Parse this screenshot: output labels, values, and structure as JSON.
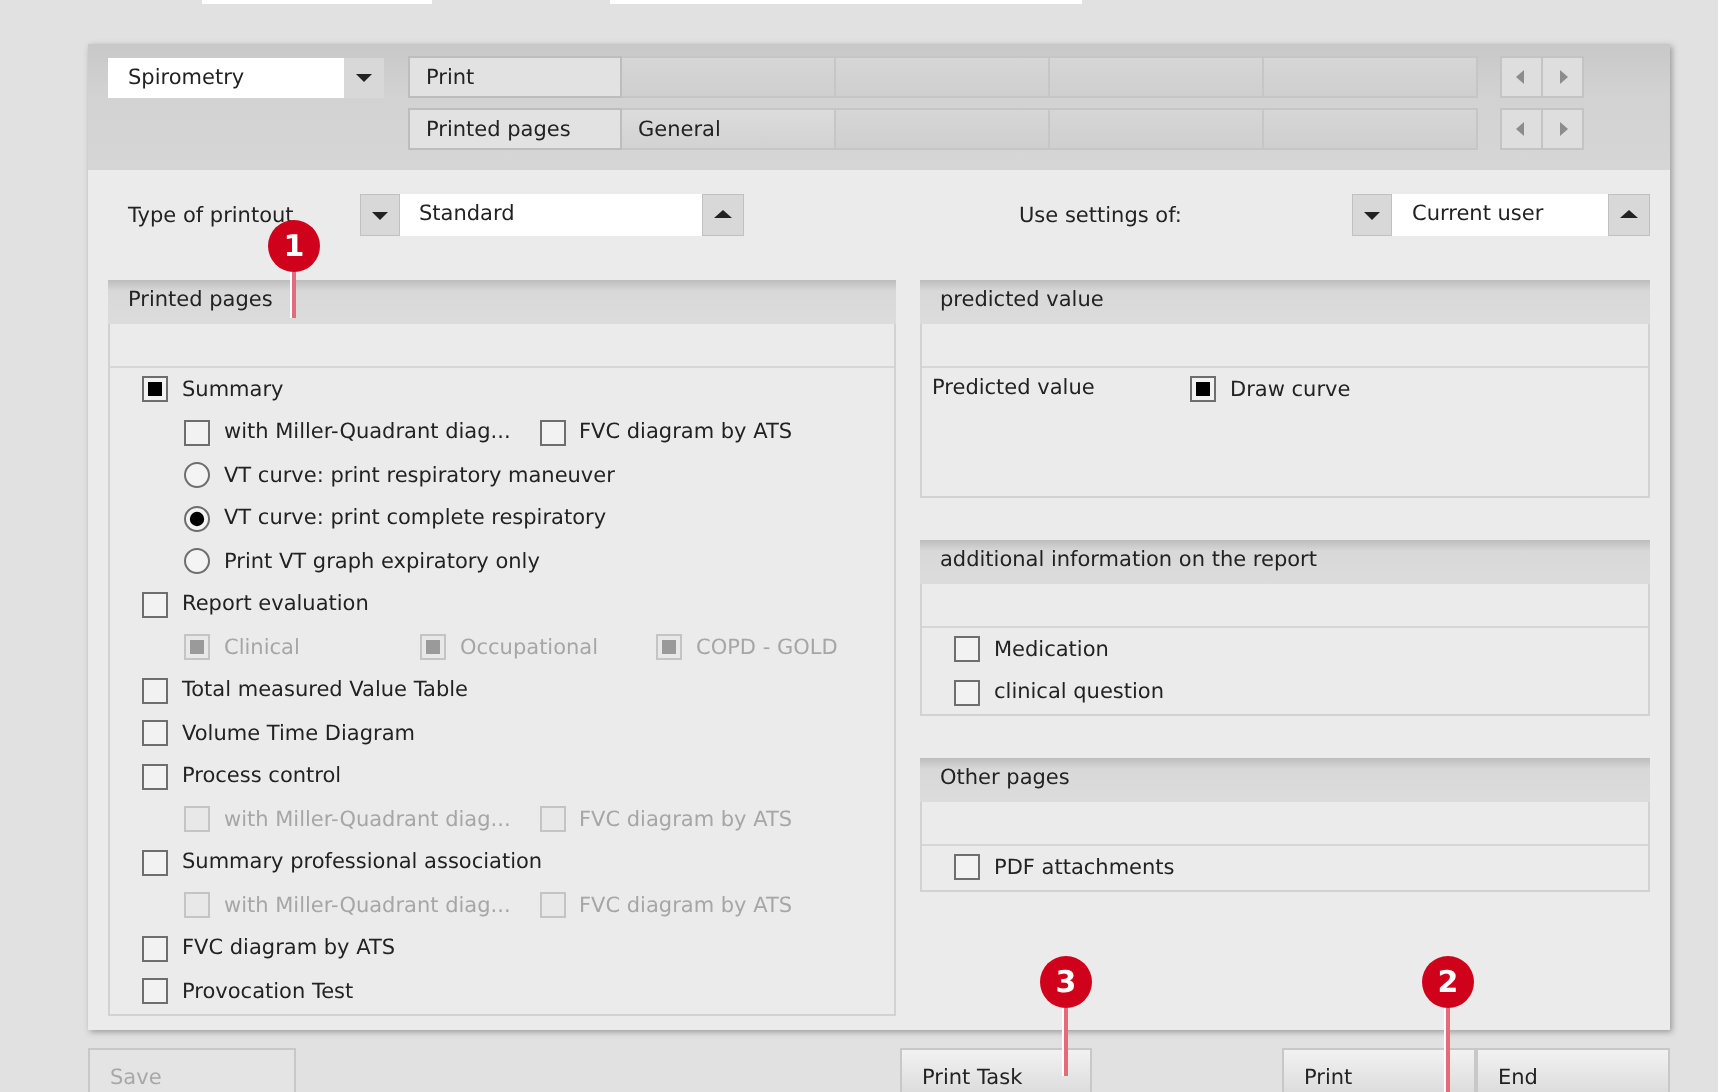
{
  "top_fields": [
    {
      "kind": "field"
    },
    {
      "kind": "field"
    }
  ],
  "module_select": {
    "value": "Spirometry"
  },
  "tab_rows": [
    {
      "tabs": [
        {
          "label": "Print",
          "selected": true
        }
      ]
    },
    {
      "tabs": [
        {
          "label": "Printed pages",
          "selected": true
        },
        {
          "label": "General",
          "selected": false
        }
      ]
    }
  ],
  "printout_type": {
    "label": "Type of printout",
    "value": "Standard"
  },
  "use_settings": {
    "label": "Use settings of:",
    "value": "Current user"
  },
  "printed_pages": {
    "title": "Printed pages",
    "items": [
      {
        "kind": "checkbox",
        "label": "Summary",
        "checked": true,
        "disabled": false,
        "rows": [
          {
            "options": [
              {
                "kind": "checkbox",
                "label": "with Miller-Quadrant diag...",
                "checked": false,
                "disabled": false
              },
              {
                "kind": "checkbox",
                "label": "FVC diagram by ATS",
                "checked": false,
                "disabled": false
              }
            ]
          },
          {
            "options": [
              {
                "kind": "radio",
                "label": "VT curve: print respiratory maneuver",
                "selected": false,
                "disabled": false
              }
            ]
          },
          {
            "options": [
              {
                "kind": "radio",
                "label": "VT curve: print complete respiratory",
                "selected": true,
                "disabled": false
              }
            ]
          },
          {
            "options": [
              {
                "kind": "radio",
                "label": "Print VT graph expiratory only",
                "selected": false,
                "disabled": false
              }
            ]
          }
        ]
      },
      {
        "kind": "checkbox",
        "label": "Report evaluation",
        "checked": false,
        "disabled": false,
        "rows": [
          {
            "options": [
              {
                "kind": "checkbox",
                "label": "Clinical",
                "checked": true,
                "disabled": true
              },
              {
                "kind": "checkbox",
                "label": "Occupational",
                "checked": true,
                "disabled": true
              },
              {
                "kind": "checkbox",
                "label": "COPD - GOLD",
                "checked": true,
                "disabled": true
              }
            ]
          }
        ]
      },
      {
        "kind": "checkbox",
        "label": "Total measured Value Table",
        "checked": false,
        "disabled": false
      },
      {
        "kind": "checkbox",
        "label": "Volume Time Diagram",
        "checked": false,
        "disabled": false
      },
      {
        "kind": "checkbox",
        "label": "Process control",
        "checked": false,
        "disabled": false,
        "rows": [
          {
            "options": [
              {
                "kind": "checkbox",
                "label": "with Miller-Quadrant diag...",
                "checked": false,
                "disabled": true
              },
              {
                "kind": "checkbox",
                "label": "FVC diagram by ATS",
                "checked": false,
                "disabled": true
              }
            ]
          }
        ]
      },
      {
        "kind": "checkbox",
        "label": "Summary professional association",
        "checked": false,
        "disabled": false,
        "rows": [
          {
            "options": [
              {
                "kind": "checkbox",
                "label": "with Miller-Quadrant diag...",
                "checked": false,
                "disabled": true
              },
              {
                "kind": "checkbox",
                "label": "FVC diagram by ATS",
                "checked": false,
                "disabled": true
              }
            ]
          }
        ]
      },
      {
        "kind": "checkbox",
        "label": "FVC diagram by ATS",
        "checked": false,
        "disabled": false
      },
      {
        "kind": "checkbox",
        "label": "Provocation Test",
        "checked": false,
        "disabled": false
      }
    ]
  },
  "predicted_value": {
    "title": "predicted value",
    "label": "Predicted value",
    "option": {
      "kind": "checkbox",
      "label": "Draw curve",
      "checked": true,
      "disabled": false
    }
  },
  "additional_information": {
    "title": "additional information on the report",
    "items": [
      {
        "kind": "checkbox",
        "label": "Medication",
        "checked": false,
        "disabled": false
      },
      {
        "kind": "checkbox",
        "label": "clinical question",
        "checked": false,
        "disabled": false
      }
    ]
  },
  "other_pages": {
    "title": "Other pages",
    "items": [
      {
        "kind": "checkbox",
        "label": "PDF attachments",
        "checked": false,
        "disabled": false
      }
    ]
  },
  "buttons": [
    {
      "label": "Save",
      "disabled": true
    },
    {
      "label": "Print Task",
      "disabled": false
    },
    {
      "label": "Print",
      "disabled": false
    },
    {
      "label": "End",
      "disabled": false
    }
  ],
  "callouts": [
    {
      "number": "1"
    },
    {
      "number": "2"
    },
    {
      "number": "3"
    }
  ]
}
